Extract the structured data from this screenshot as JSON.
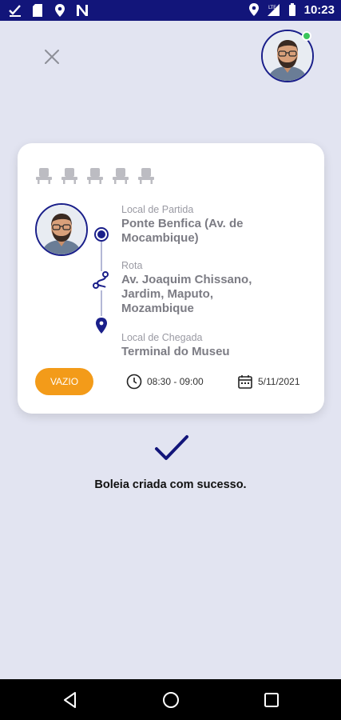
{
  "status_bar": {
    "time": "10:23",
    "network": "LTE"
  },
  "trip_card": {
    "seats": [
      "seat-1",
      "seat-2",
      "seat-3",
      "seat-4",
      "seat-5"
    ],
    "departure": {
      "label": "Local de Partida",
      "value_line1": "Ponte Benfica (Av. de",
      "value_line2": "Mocambique)"
    },
    "route": {
      "label": "Rota",
      "value_line1": "Av. Joaquim Chissano,",
      "value_line2": "Jardim, Maputo,",
      "value_line3": "Mozambique"
    },
    "arrival": {
      "label": "Local de Chegada",
      "value": "Terminal do Museu"
    },
    "status": "VAZIO",
    "time_range": "08:30 - 09:00",
    "date": "5/11/2021"
  },
  "success_message": "Boleia criada com sucesso.",
  "colors": {
    "primary": "#12157a",
    "accent": "#f39b19",
    "background": "#e2e4f1",
    "online": "#3cc55c"
  }
}
